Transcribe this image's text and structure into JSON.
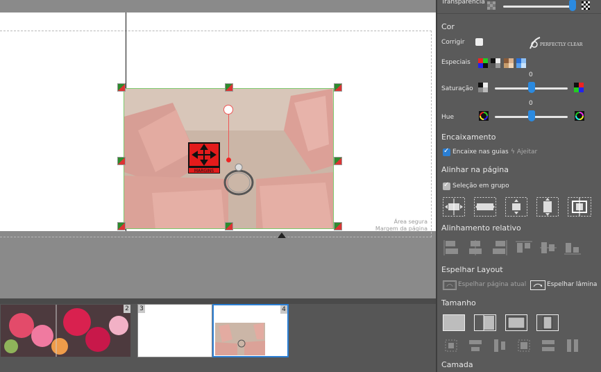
{
  "canvas": {
    "safe_area_label": "Área segura",
    "page_margin_label": "Margem da página",
    "move_label": "MARGINS"
  },
  "thumbnails": [
    {
      "number": "2"
    },
    {
      "number": "3"
    },
    {
      "number": "4"
    }
  ],
  "panel": {
    "transparency_label": "Transparência",
    "color_section": "Cor",
    "correct_label": "Corrigir",
    "perfectly_clear_label": "PERFECTLY CLEAR",
    "special_label": "Especiais",
    "saturation_label": "Saturação",
    "saturation_value": "0",
    "hue_label": "Hue",
    "hue_value": "0",
    "fit_section": "Encaixamento",
    "snap_label": "Encaixe nas guias",
    "adjust_label": "Ajeitar",
    "align_page_section": "Alinhar na página",
    "group_selection_label": "Seleção em grupo",
    "relative_align_section": "Alinhamento relativo",
    "mirror_section": "Espelhar Layout",
    "mirror_current_label": "Espelhar página atual",
    "mirror_spread_label": "Espelhar lâmina",
    "size_section": "Tamanho",
    "layer_section": "Camada"
  },
  "sliders": {
    "transparency": 1.0,
    "saturation": 0.5,
    "hue": 0.5
  },
  "colors": {
    "accent": "#2b8ae0",
    "selection": "#7cc96c",
    "move_button": "#e31b1b"
  }
}
